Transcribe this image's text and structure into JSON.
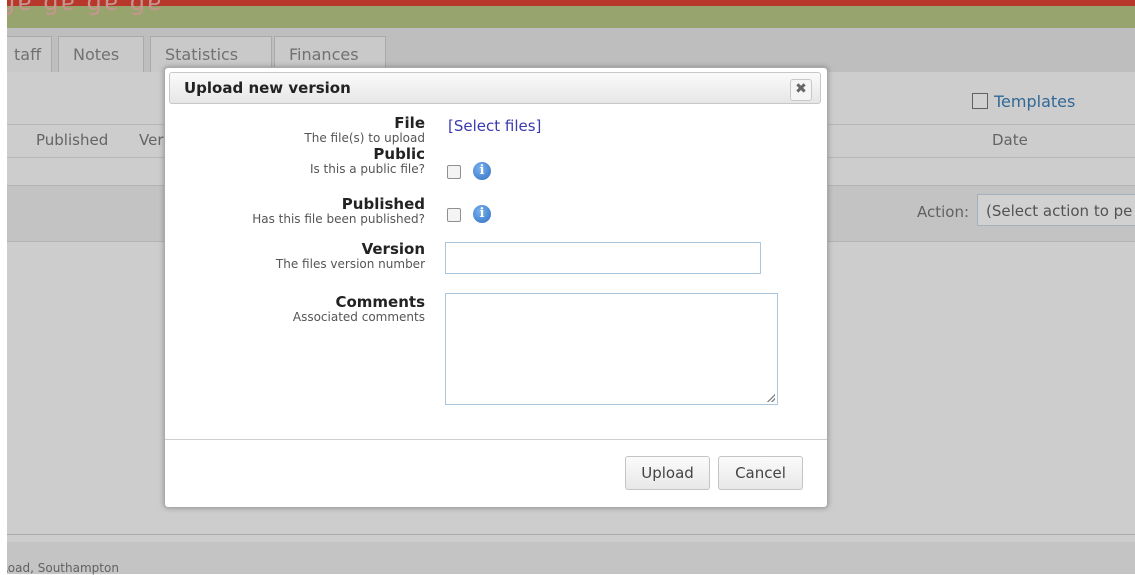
{
  "app": {
    "top_banner_text": "ɡɐ ɡɐ ɡɐ ɡɐ",
    "tabs": [
      {
        "label": "taff"
      },
      {
        "label": "Notes"
      },
      {
        "label": "Statistics"
      },
      {
        "label": "Finances"
      }
    ],
    "templates_label": "Templates",
    "columns": {
      "published": "Published",
      "version_partial": "Ver",
      "date": "Date"
    },
    "action": {
      "label": "Action:",
      "selected": "(Select action to pe"
    },
    "footer_text": "Road, Southampton"
  },
  "dialog": {
    "title": "Upload new version",
    "close_glyph": "✖",
    "fields": {
      "file": {
        "label": "File",
        "sublabel": "The file(s) to upload",
        "link": "[Select files]"
      },
      "public": {
        "label": "Public",
        "sublabel": "Is this a public file?",
        "checked": false
      },
      "published": {
        "label": "Published",
        "sublabel": "Has this file been published?",
        "checked": false
      },
      "version": {
        "label": "Version",
        "sublabel": "The files version number",
        "value": ""
      },
      "comments": {
        "label": "Comments",
        "sublabel": "Associated comments",
        "value": ""
      }
    },
    "info_glyph": "i",
    "buttons": {
      "upload": "Upload",
      "cancel": "Cancel"
    }
  }
}
